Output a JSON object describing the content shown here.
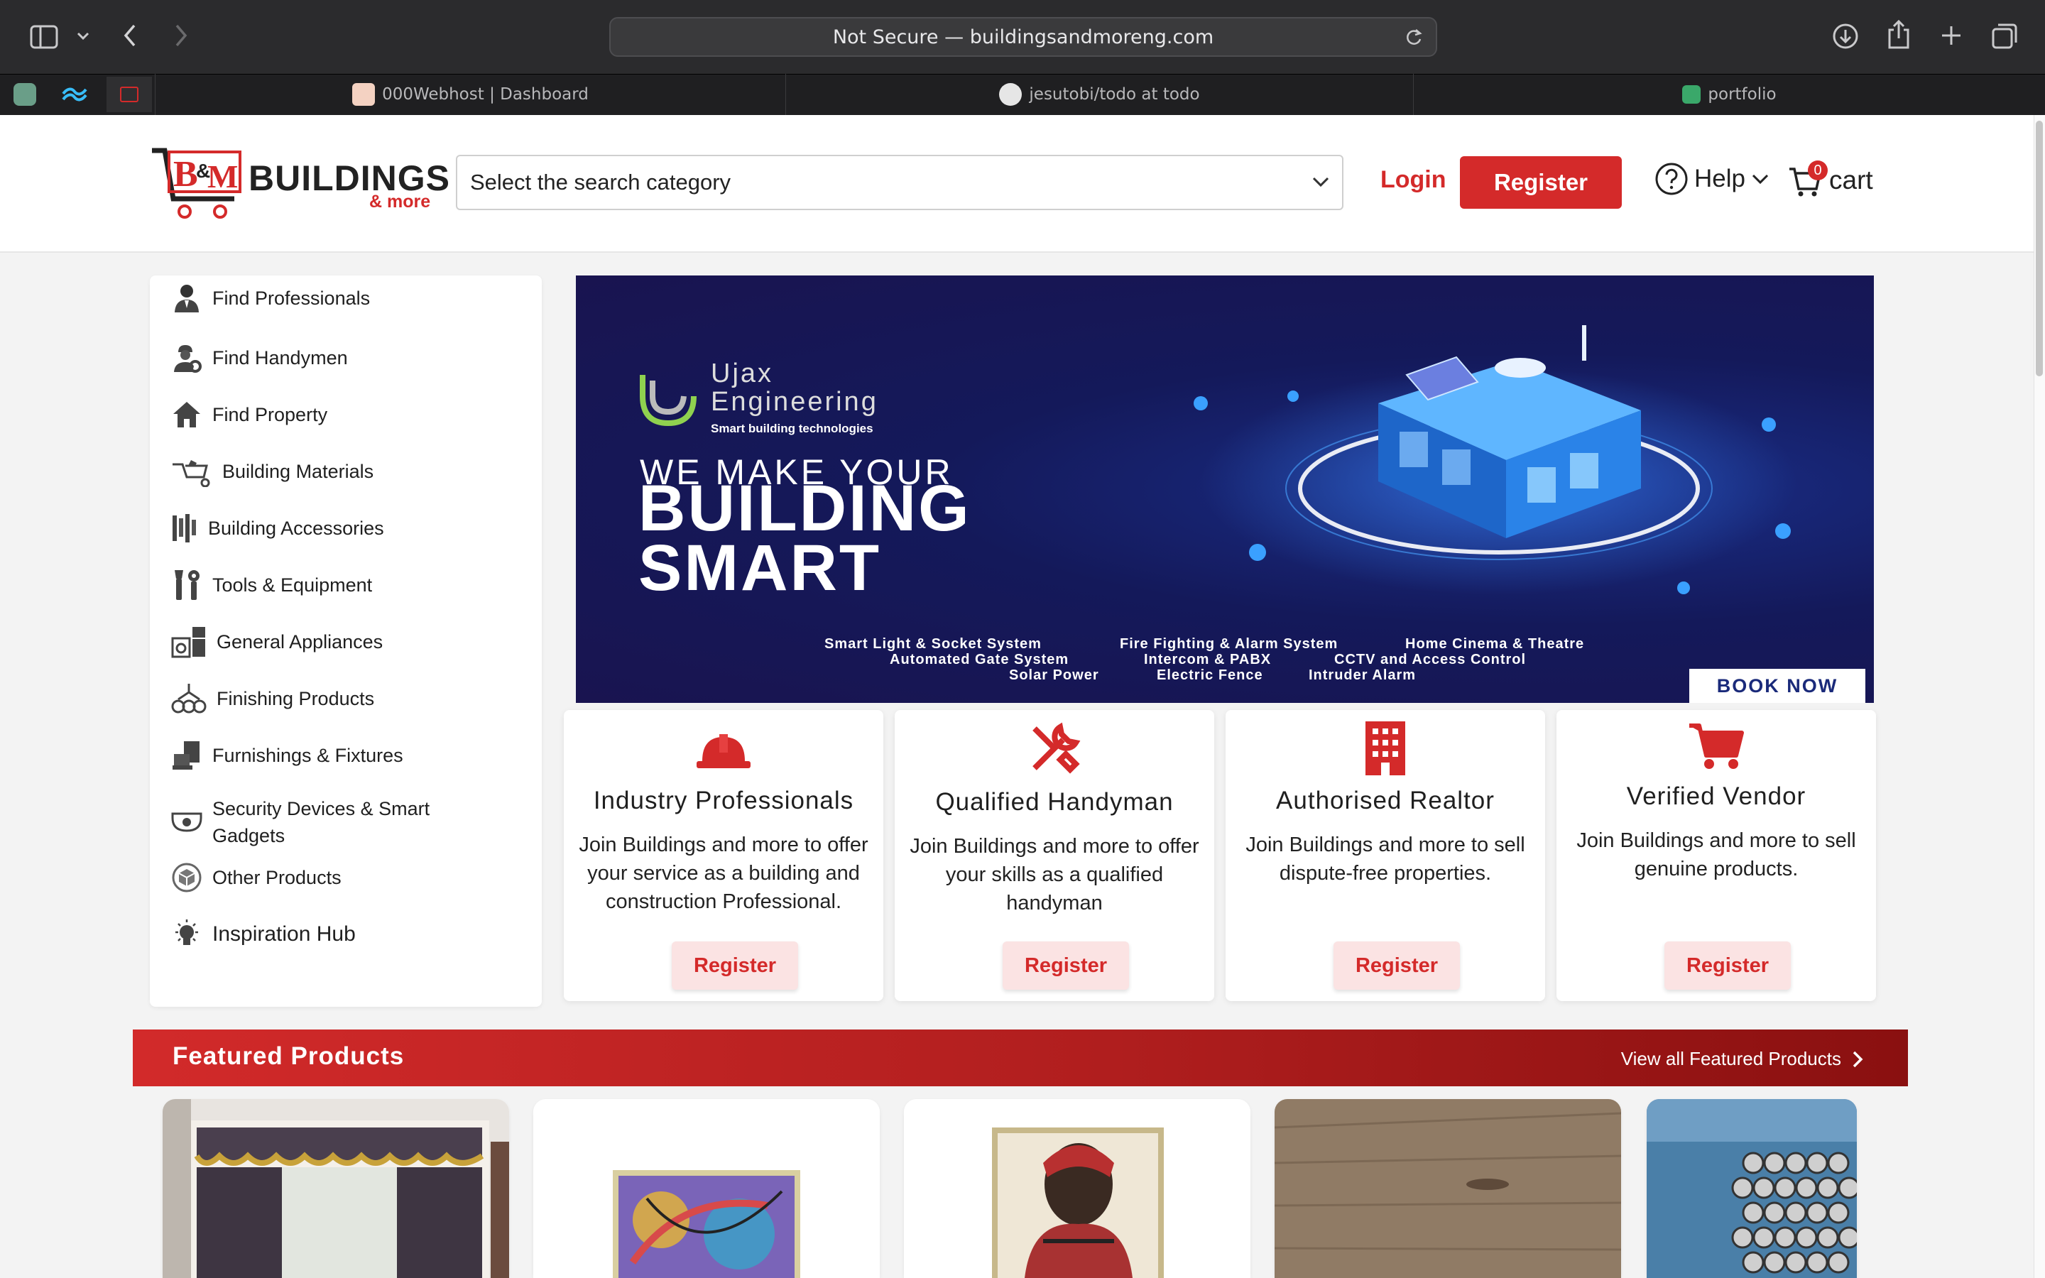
{
  "browser": {
    "url": "Not Secure — buildingsandmoreng.com",
    "tabs": [
      {
        "label": "000Webhost | Dashboard"
      },
      {
        "label": "jesutobi/todo at todo"
      },
      {
        "label": "portfolio"
      }
    ]
  },
  "header": {
    "logo_brand": "BUILDINGS",
    "logo_sub": "& more",
    "logo_mark": "B&M",
    "search_category": "Select the search category",
    "login_label": "Login",
    "register_label": "Register",
    "help_label": "Help",
    "cart_label": "cart",
    "cart_count": "0"
  },
  "sidebar": {
    "items": [
      {
        "label": "Find Professionals",
        "icon": "professional-icon"
      },
      {
        "label": "Find Handymen",
        "icon": "handyman-icon"
      },
      {
        "label": "Find Property",
        "icon": "house-icon"
      },
      {
        "label": "Building Materials",
        "icon": "wheelbarrow-icon"
      },
      {
        "label": "Building Accessories",
        "icon": "accessories-icon"
      },
      {
        "label": "Tools & Equipment",
        "icon": "tools-icon"
      },
      {
        "label": "General Appliances",
        "icon": "appliances-icon"
      },
      {
        "label": "Finishing Products",
        "icon": "paint-icon"
      },
      {
        "label": "Furnishings & Fixtures",
        "icon": "furniture-icon"
      },
      {
        "label": "Security Devices & Smart Gadgets",
        "icon": "camera-icon"
      },
      {
        "label": "Other Products",
        "icon": "box-icon"
      },
      {
        "label": "Inspiration Hub",
        "icon": "bulb-icon"
      }
    ]
  },
  "banner": {
    "company_name_1": "Ujax",
    "company_name_2": "Engineering",
    "company_tagline": "Smart building technologies",
    "headline_1": "WE MAKE YOUR",
    "headline_2": "BUILDING",
    "headline_3": "SMART",
    "features": [
      "Smart Light & Socket System",
      "Fire Fighting & Alarm System",
      "Home Cinema & Theatre",
      "Automated Gate System",
      "Intercom & PABX",
      "CCTV and Access Control",
      "Solar Power",
      "Electric Fence",
      "Intruder Alarm"
    ],
    "cta": "BOOK NOW"
  },
  "cards": [
    {
      "title": "Industry Professionals",
      "desc": "Join Buildings and more to offer your service as a building and construction Professional.",
      "button": "Register",
      "icon": "hardhat-icon"
    },
    {
      "title": "Qualified Handyman",
      "desc": "Join Buildings and more to offer your skills as a qualified handyman",
      "button": "Register",
      "icon": "wrench-screwdriver-icon"
    },
    {
      "title": "Authorised Realtor",
      "desc": "Join Buildings and more to sell dispute-free properties.",
      "button": "Register",
      "icon": "building-icon"
    },
    {
      "title": "Verified Vendor",
      "desc": "Join Buildings and more to sell genuine products.",
      "button": "Register",
      "icon": "shopping-cart-icon"
    }
  ],
  "featured": {
    "title": "Featured Products",
    "view_all": "View all Featured Products"
  },
  "colors": {
    "brand_red": "#d42a2a",
    "banner_navy": "#191450",
    "chrome_dark": "#2b2b2d"
  }
}
